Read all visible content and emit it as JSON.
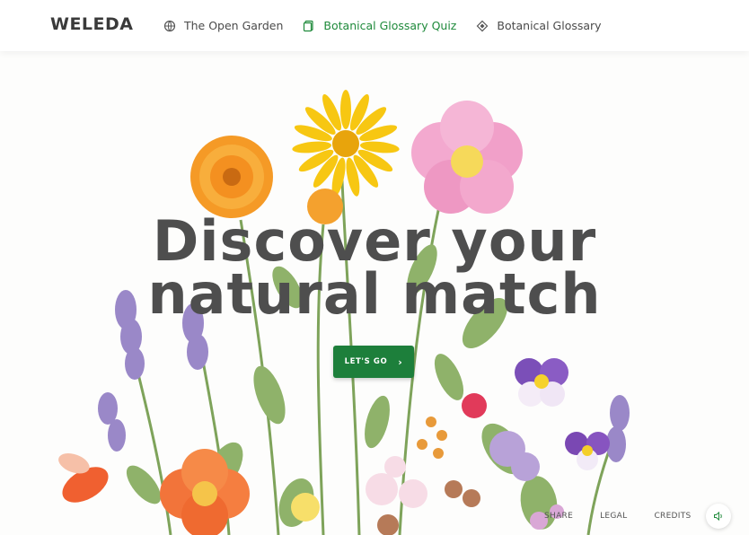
{
  "brand": {
    "logo": "WELEDA"
  },
  "nav": {
    "items": [
      {
        "label": "The Open Garden",
        "icon": "globe-icon"
      },
      {
        "label": "Botanical Glossary Quiz",
        "icon": "quiz-icon",
        "active": true
      },
      {
        "label": "Botanical Glossary",
        "icon": "diamond-icon"
      }
    ]
  },
  "hero": {
    "headline_line1": "Discover your",
    "headline_line2": "natural match",
    "cta_label": "LET'S GO"
  },
  "footer": {
    "share": "SHARE",
    "legal": "LEGAL",
    "credits": "CREDITS",
    "sound_icon": "speaker-icon"
  },
  "colors": {
    "accent": "#1f8a3b",
    "cta": "#1d7f3b",
    "headline": "#4e4e4e"
  }
}
